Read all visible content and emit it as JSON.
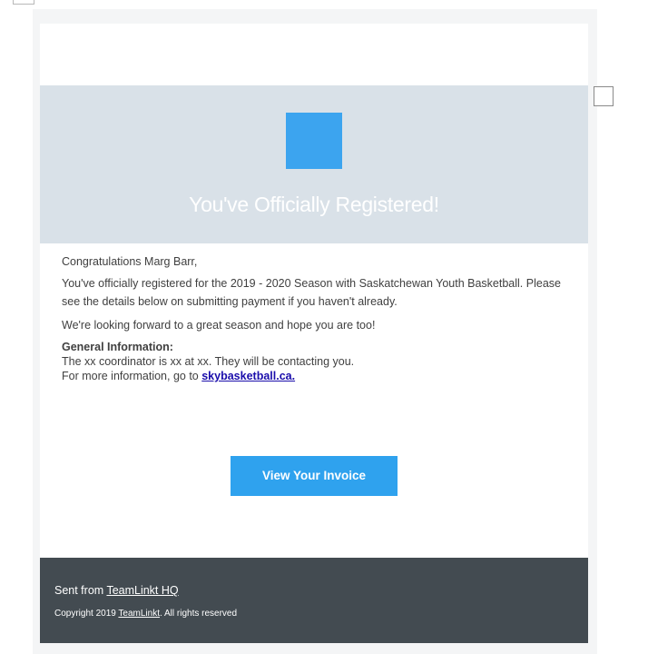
{
  "hero": {
    "title": "You've Officially Registered!",
    "logo_color": "#3ca4ef",
    "background_color": "#d9e1e8"
  },
  "body": {
    "greeting": "Congratulations Marg Barr,",
    "paragraph1": "You've officially registered for the 2019 - 2020 Season with Saskatchewan Youth Basketball.  Please see the details below on submitting payment if you haven't already.",
    "paragraph2": "We're looking forward to a great season and hope you are too!",
    "info_heading": "General Information:",
    "info_line1": "The xx coordinator is xx at xx. They will be contacting you.",
    "info_line2_prefix": "For more information, go to ",
    "info_link": "skybasketball.ca."
  },
  "button": {
    "label": "View Your Invoice",
    "color": "#2fa2ee"
  },
  "footer": {
    "sent_from_prefix": "Sent from ",
    "sent_from_link": "TeamLinkt HQ",
    "copyright_prefix": "Copyright 2019 ",
    "copyright_link": "TeamLinkt",
    "copyright_suffix": ". All rights reserved",
    "background_color": "#434b51"
  }
}
